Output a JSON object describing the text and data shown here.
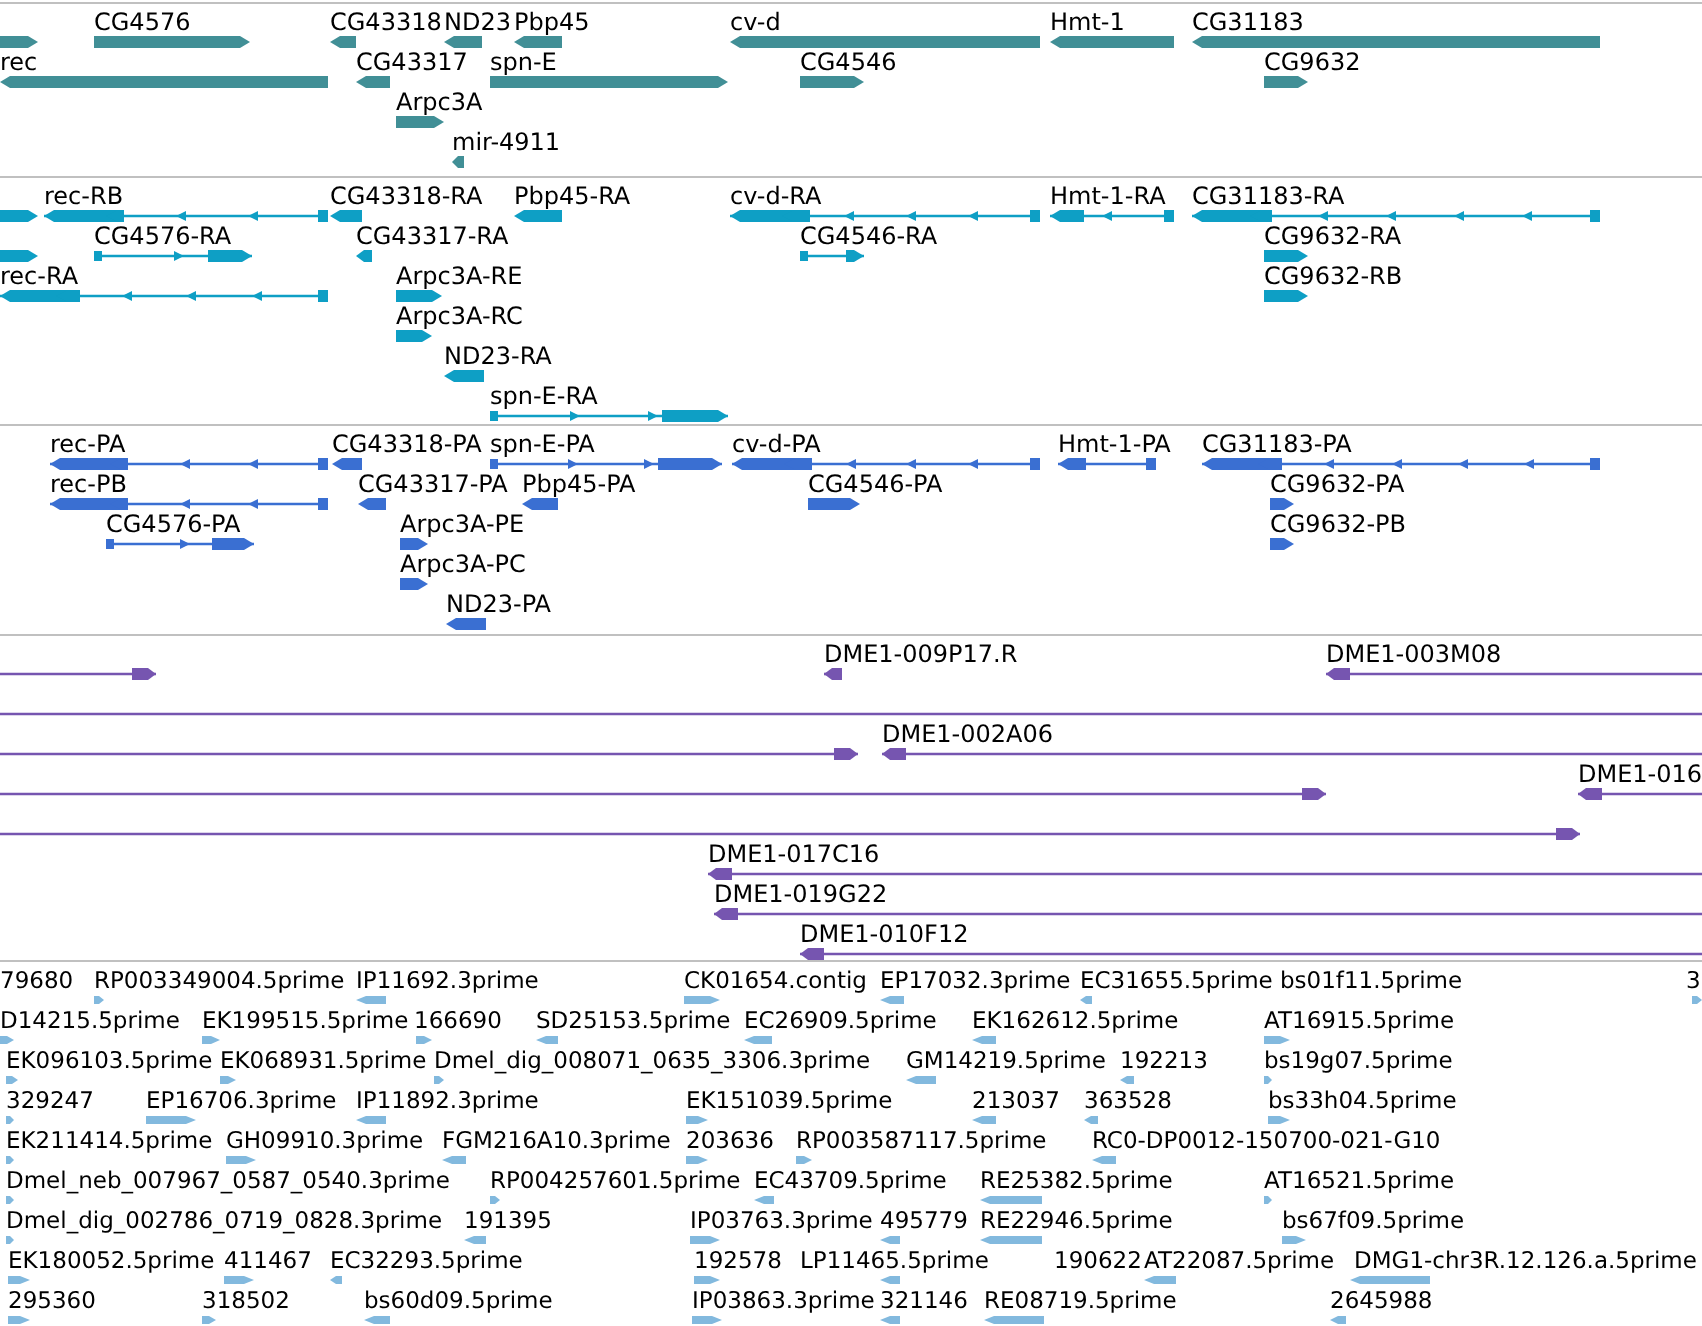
{
  "tracks": [
    {
      "kind": "gene",
      "lanes": [
        {
          "features": [
            {
              "reverse": false
            },
            {
              "label": "CG4576",
              "reverse": false
            },
            {
              "label": "CG43318",
              "reverse": true
            },
            {
              "label": "ND23",
              "reverse": true
            },
            {
              "label": "Pbp45",
              "reverse": true
            },
            {
              "label": "cv-d",
              "reverse": true
            },
            {
              "label": "Hmt-1",
              "reverse": true
            },
            {
              "label": "CG31183",
              "reverse": true
            }
          ]
        },
        {
          "features": [
            {
              "label": "rec",
              "reverse": true
            },
            {
              "label": "CG43317",
              "reverse": true
            },
            {
              "label": "spn-E",
              "reverse": false
            },
            {
              "label": "CG4546",
              "reverse": false
            },
            {
              "label": "CG9632",
              "reverse": false
            }
          ]
        },
        {
          "features": [
            {
              "label": "Arpc3A",
              "reverse": false
            }
          ]
        },
        {
          "features": [
            {
              "label": "mir-4911",
              "reverse": true
            }
          ]
        }
      ]
    },
    {
      "kind": "transcript",
      "lanes": [
        {
          "features": [
            {
              "reverse": false
            },
            {
              "label": "rec-RB",
              "reverse": true
            },
            {
              "label": "CG43318-RA",
              "reverse": true
            },
            {
              "label": "Pbp45-RA",
              "reverse": true
            },
            {
              "label": "cv-d-RA",
              "reverse": true
            },
            {
              "label": "Hmt-1-RA",
              "reverse": true
            },
            {
              "label": "CG31183-RA",
              "reverse": true
            }
          ]
        },
        {
          "features": [
            {
              "reverse": false
            },
            {
              "label": "CG4576-RA",
              "reverse": false
            },
            {
              "label": "CG43317-RA",
              "reverse": true
            },
            {
              "label": "CG4546-RA",
              "reverse": false
            },
            {
              "label": "CG9632-RA",
              "reverse": false
            }
          ]
        },
        {
          "features": [
            {
              "label": "rec-RA",
              "reverse": true
            },
            {
              "label": "Arpc3A-RE",
              "reverse": false
            },
            {
              "label": "CG9632-RB",
              "reverse": false
            }
          ]
        },
        {
          "features": [
            {
              "label": "Arpc3A-RC",
              "reverse": false
            }
          ]
        },
        {
          "features": [
            {
              "label": "ND23-RA",
              "reverse": true
            }
          ]
        },
        {
          "features": [
            {
              "label": "spn-E-RA",
              "reverse": false
            }
          ]
        }
      ]
    },
    {
      "kind": "protein",
      "lanes": [
        {
          "features": [
            {
              "label": "rec-PA",
              "reverse": true
            },
            {
              "label": "CG43318-PA",
              "reverse": true
            },
            {
              "label": "spn-E-PA",
              "reverse": false
            },
            {
              "label": "cv-d-PA",
              "reverse": true
            },
            {
              "label": "Hmt-1-PA",
              "reverse": true
            },
            {
              "label": "CG31183-PA",
              "reverse": true
            }
          ]
        },
        {
          "features": [
            {
              "label": "rec-PB",
              "reverse": true
            },
            {
              "label": "CG43317-PA",
              "reverse": true
            },
            {
              "label": "Pbp45-PA",
              "reverse": true
            },
            {
              "label": "CG4546-PA",
              "reverse": false
            },
            {
              "label": "CG9632-PA",
              "reverse": false
            }
          ]
        },
        {
          "features": [
            {
              "label": "CG4576-PA",
              "reverse": false
            },
            {
              "label": "Arpc3A-PE",
              "reverse": false
            },
            {
              "label": "CG9632-PB",
              "reverse": false
            }
          ]
        },
        {
          "features": [
            {
              "label": "Arpc3A-PC",
              "reverse": false
            }
          ]
        },
        {
          "features": [
            {
              "label": "ND23-PA",
              "reverse": true
            }
          ]
        }
      ]
    },
    {
      "kind": "clone",
      "lanes": [
        {
          "features": [
            {
              "reverse": false
            },
            {
              "label": "DME1-009P17.R",
              "reverse": true
            },
            {
              "label": "DME1-003M08",
              "reverse": true
            }
          ]
        },
        {
          "features": [
            {
              "kind": "line"
            }
          ]
        },
        {
          "features": [
            {
              "reverse": false
            },
            {
              "label": "DME1-002A06",
              "reverse": true
            }
          ]
        },
        {
          "features": [
            {
              "reverse": false
            },
            {
              "label": "DME1-016",
              "reverse": true
            }
          ]
        },
        {
          "features": [
            {
              "reverse": false
            }
          ]
        },
        {
          "features": [
            {
              "label": "DME1-017C16",
              "reverse": true
            }
          ]
        },
        {
          "features": [
            {
              "label": "DME1-019G22",
              "reverse": true
            }
          ]
        },
        {
          "features": [
            {
              "label": "DME1-010F12",
              "reverse": true
            }
          ]
        }
      ]
    },
    {
      "kind": "est",
      "lanes": [
        {
          "features": [
            {
              "label": "79680"
            },
            {
              "label": "RP003349004.5prime",
              "reverse": false
            },
            {
              "label": "IP11692.3prime",
              "reverse": true
            },
            {
              "label": "CK01654.contig",
              "reverse": false
            },
            {
              "label": "EP17032.3prime",
              "reverse": true
            },
            {
              "label": "EC31655.5prime",
              "reverse": true
            },
            {
              "label": "bs01f11.5prime"
            },
            {
              "label": "3",
              "reverse": false
            }
          ]
        },
        {
          "features": [
            {
              "label": "D14215.5prime",
              "reverse": false
            },
            {
              "label": "EK199515.5prime",
              "reverse": false
            },
            {
              "label": "166690",
              "reverse": false
            },
            {
              "label": "SD25153.5prime",
              "reverse": true
            },
            {
              "label": "EC26909.5prime",
              "reverse": true
            },
            {
              "label": "EK162612.5prime",
              "reverse": true
            },
            {
              "label": "AT16915.5prime",
              "reverse": false
            }
          ]
        },
        {
          "features": [
            {
              "label": "EK096103.5prime",
              "reverse": false
            },
            {
              "label": "EK068931.5prime",
              "reverse": false
            },
            {
              "label": "Dmel_dig_008071_0635_3306.3prime",
              "reverse": false
            },
            {
              "label": "GM14219.5prime",
              "reverse": true
            },
            {
              "label": "192213",
              "reverse": true
            },
            {
              "label": "bs19g07.5prime",
              "reverse": false
            }
          ]
        },
        {
          "features": [
            {
              "label": "329247",
              "reverse": false
            },
            {
              "label": "EP16706.3prime",
              "reverse": false
            },
            {
              "label": "IP11892.3prime",
              "reverse": true
            },
            {
              "label": "EK151039.5prime",
              "reverse": false
            },
            {
              "label": "213037",
              "reverse": true
            },
            {
              "label": "363528",
              "reverse": true
            },
            {
              "label": "bs33h04.5prime",
              "reverse": false
            }
          ]
        },
        {
          "features": [
            {
              "label": "EK211414.5prime",
              "reverse": false
            },
            {
              "label": "GH09910.3prime",
              "reverse": false
            },
            {
              "label": "FGM216A10.3prime",
              "reverse": true
            },
            {
              "label": "203636",
              "reverse": false
            },
            {
              "label": "RP003587117.5prime",
              "reverse": false
            },
            {
              "label": "RC0-DP0012-150700-021-G10",
              "reverse": true
            }
          ]
        },
        {
          "features": [
            {
              "label": "Dmel_neb_007967_0587_0540.3prime",
              "reverse": false
            },
            {
              "label": "RP004257601.5prime",
              "reverse": false
            },
            {
              "label": "EC43709.5prime",
              "reverse": true
            },
            {
              "label": "RE25382.5prime",
              "reverse": true
            },
            {
              "label": "AT16521.5prime",
              "reverse": false
            }
          ]
        },
        {
          "features": [
            {
              "label": "Dmel_dig_002786_0719_0828.3prime",
              "reverse": false
            },
            {
              "label": "191395",
              "reverse": true
            },
            {
              "label": "IP03763.3prime",
              "reverse": false
            },
            {
              "label": "495779",
              "reverse": true
            },
            {
              "label": "RE22946.5prime",
              "reverse": true
            },
            {
              "label": "bs67f09.5prime",
              "reverse": false
            }
          ]
        },
        {
          "features": [
            {
              "label": "EK180052.5prime",
              "reverse": false
            },
            {
              "label": "411467",
              "reverse": false
            },
            {
              "label": "EC32293.5prime",
              "reverse": true
            },
            {
              "label": "192578",
              "reverse": false
            },
            {
              "label": "LP11465.5prime",
              "reverse": true
            },
            {
              "label": "190622"
            },
            {
              "label": "AT22087.5prime",
              "reverse": true
            },
            {
              "label": "DMG1-chr3R.12.126.a.5prime",
              "reverse": true
            }
          ]
        },
        {
          "features": [
            {
              "label": "295360",
              "reverse": false
            },
            {
              "label": "318502",
              "reverse": false
            },
            {
              "label": "bs60d09.5prime",
              "reverse": true
            },
            {
              "label": "IP03863.3prime",
              "reverse": false
            },
            {
              "label": "321146",
              "reverse": true
            },
            {
              "label": "RE08719.5prime",
              "reverse": true
            },
            {
              "label": "2645988",
              "reverse": true
            }
          ]
        }
      ]
    }
  ]
}
